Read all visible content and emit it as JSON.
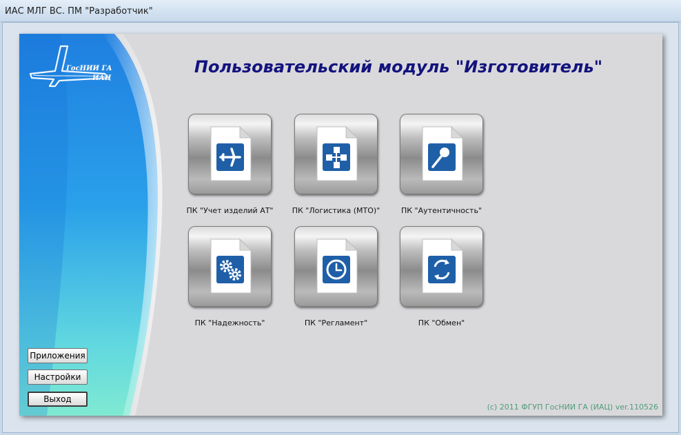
{
  "window": {
    "title": "ИАС МЛГ ВС. ПМ \"Разработчик\""
  },
  "logo": {
    "line1": "ГосНИИ ГА",
    "line2": "ИАЦ"
  },
  "page": {
    "title": "Пользовательский модуль \"Изготовитель\""
  },
  "modules": [
    {
      "label": "ПК \"Учет изделий АТ\"",
      "icon": "airplane-icon"
    },
    {
      "label": "ПК \"Логистика (МТО)\"",
      "icon": "network-icon"
    },
    {
      "label": "ПК \"Аутентичность\"",
      "icon": "magnifier-icon"
    },
    {
      "label": "ПК \"Надежность\"",
      "icon": "gears-icon"
    },
    {
      "label": "ПК \"Регламент\"",
      "icon": "clock-icon"
    },
    {
      "label": "ПК \"Обмен\"",
      "icon": "sync-icon"
    }
  ],
  "buttons": {
    "apps": "Приложения",
    "settings": "Настройки",
    "exit": "Выход"
  },
  "footer": {
    "copyright": "(c) 2011 ФГУП ГосНИИ ГА (ИАЦ) ver.110526"
  },
  "colors": {
    "title": "#13137e",
    "icon_blue": "#1f5fa8",
    "copyright": "#4f9a78"
  }
}
